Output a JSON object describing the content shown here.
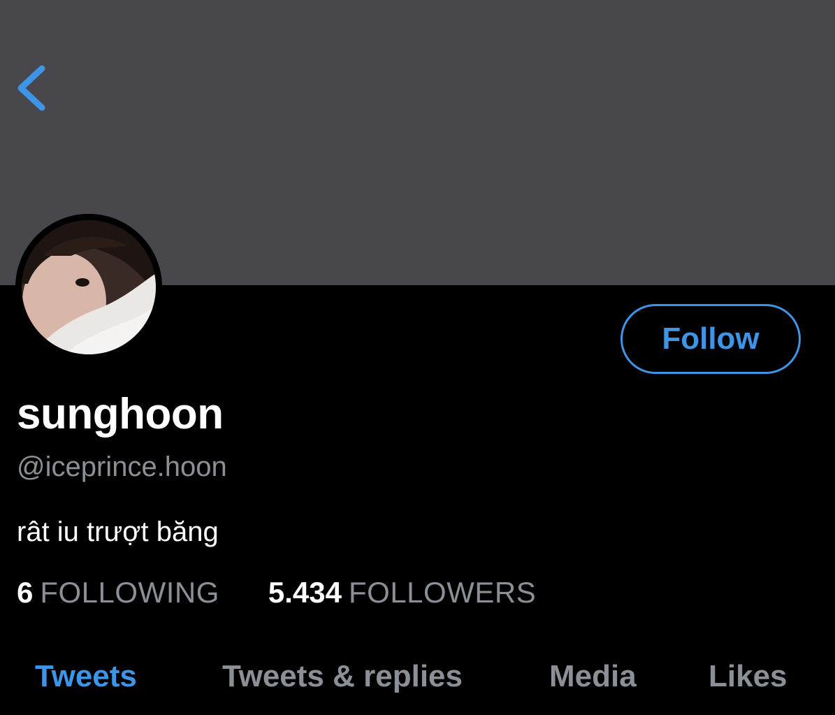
{
  "profile": {
    "display_name": "sunghoon",
    "handle": "@iceprince.hoon",
    "bio": "rât iu trượt băng",
    "following_count": "6",
    "following_label": "FOLLOWING",
    "followers_count": "5.434",
    "followers_label": "FOLLOWERS"
  },
  "actions": {
    "follow_label": "Follow"
  },
  "tabs": [
    {
      "label": "Tweets",
      "active": true
    },
    {
      "label": "Tweets & replies",
      "active": false
    },
    {
      "label": "Media",
      "active": false
    },
    {
      "label": "Likes",
      "active": false
    }
  ],
  "icons": {
    "back": "chevron-left-icon"
  },
  "colors": {
    "banner": "#48474c",
    "background": "#000000",
    "accent": "#3e95e6",
    "secondary_text": "#8b8f96",
    "primary_text": "#ffffff"
  }
}
